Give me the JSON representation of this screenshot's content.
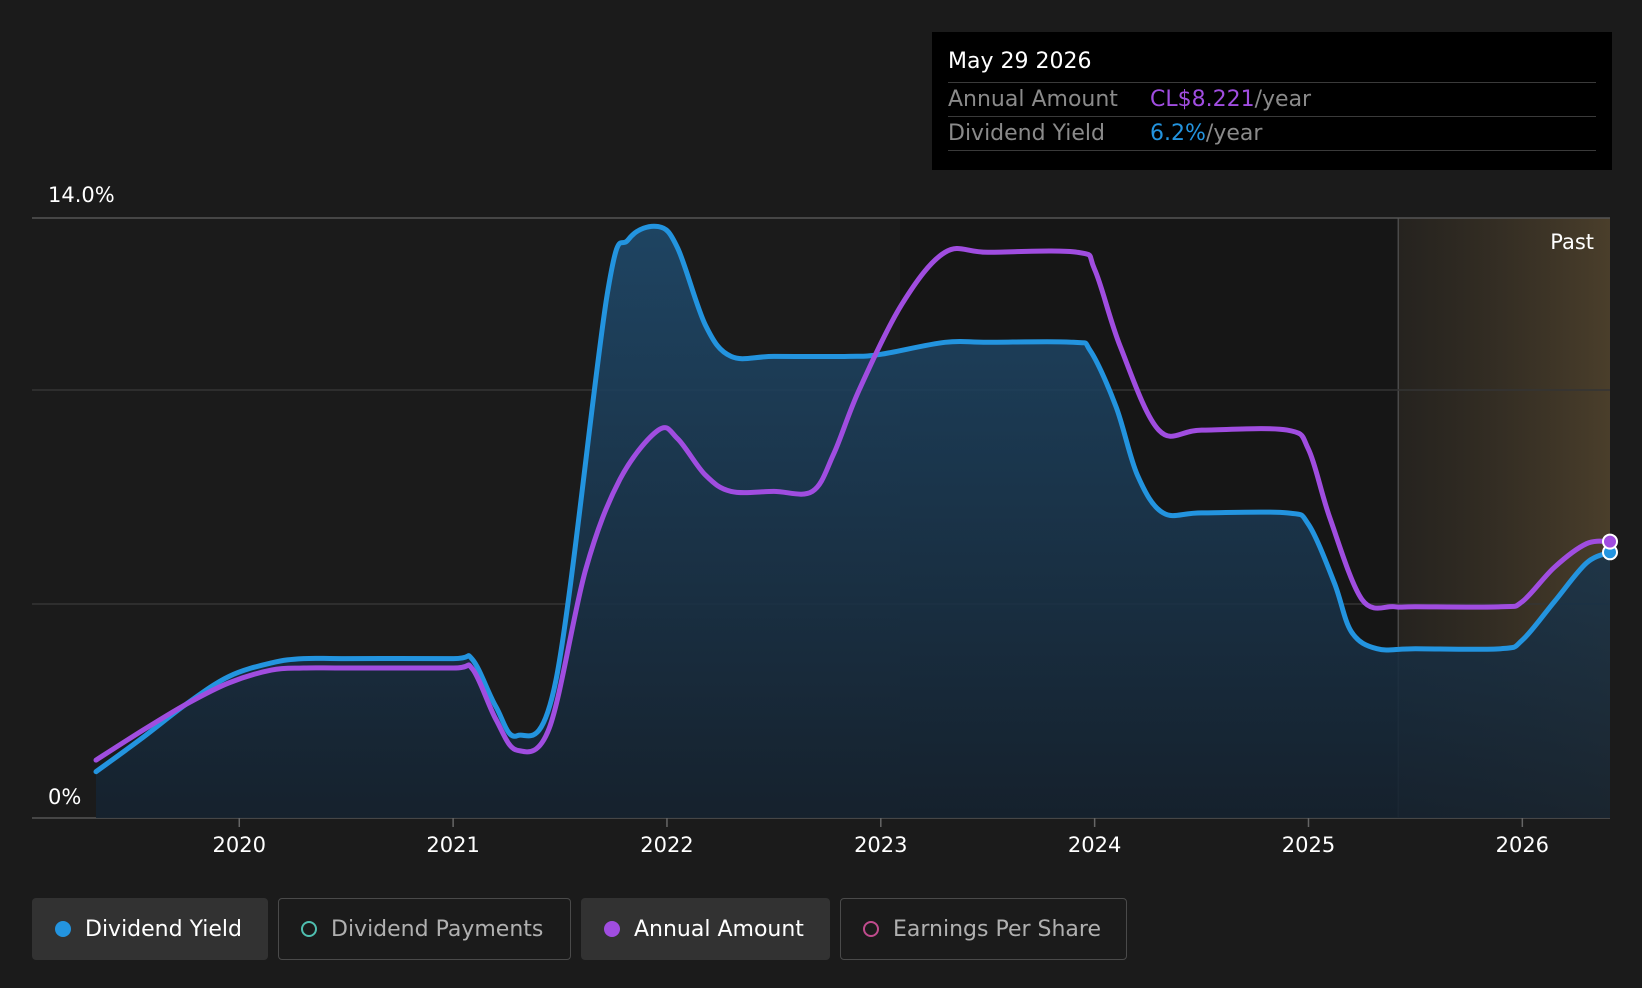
{
  "chart_data": {
    "type": "line",
    "y_top_label": "14.0%",
    "y_bottom_label": "0%",
    "ylim": [
      0,
      14
    ],
    "x_range": [
      2019.33,
      2026.41
    ],
    "x_ticks": [
      "2020",
      "2021",
      "2022",
      "2023",
      "2024",
      "2025",
      "2026"
    ],
    "past_label": "Past",
    "past_start": 2025.42,
    "series": [
      {
        "name": "Dividend Yield",
        "color": "#2394df",
        "fill": true,
        "points": [
          [
            2019.33,
            1.08
          ],
          [
            2019.55,
            1.88
          ],
          [
            2019.75,
            2.65
          ],
          [
            2019.95,
            3.3
          ],
          [
            2020.15,
            3.62
          ],
          [
            2020.3,
            3.72
          ],
          [
            2020.5,
            3.72
          ],
          [
            2021.0,
            3.72
          ],
          [
            2021.09,
            3.7
          ],
          [
            2021.2,
            2.6
          ],
          [
            2021.3,
            1.92
          ],
          [
            2021.48,
            3.2
          ],
          [
            2021.72,
            12.2
          ],
          [
            2021.82,
            13.5
          ],
          [
            2021.96,
            13.8
          ],
          [
            2022.05,
            13.3
          ],
          [
            2022.18,
            11.5
          ],
          [
            2022.3,
            10.77
          ],
          [
            2022.5,
            10.77
          ],
          [
            2022.85,
            10.77
          ],
          [
            2023.0,
            10.82
          ],
          [
            2023.3,
            11.1
          ],
          [
            2023.5,
            11.1
          ],
          [
            2023.9,
            11.1
          ],
          [
            2023.98,
            10.9
          ],
          [
            2024.1,
            9.6
          ],
          [
            2024.2,
            8.0
          ],
          [
            2024.32,
            7.12
          ],
          [
            2024.5,
            7.12
          ],
          [
            2024.9,
            7.12
          ],
          [
            2025.0,
            6.85
          ],
          [
            2025.12,
            5.5
          ],
          [
            2025.2,
            4.35
          ],
          [
            2025.32,
            3.95
          ],
          [
            2025.5,
            3.95
          ],
          [
            2025.9,
            3.95
          ],
          [
            2026.0,
            4.15
          ],
          [
            2026.15,
            5.05
          ],
          [
            2026.3,
            5.95
          ],
          [
            2026.41,
            6.2
          ]
        ]
      },
      {
        "name": "Annual Amount",
        "color": "#a04de0",
        "fill": false,
        "points": [
          [
            2019.33,
            1.35
          ],
          [
            2019.55,
            2.05
          ],
          [
            2019.75,
            2.65
          ],
          [
            2019.95,
            3.15
          ],
          [
            2020.15,
            3.45
          ],
          [
            2020.3,
            3.5
          ],
          [
            2020.5,
            3.5
          ],
          [
            2021.0,
            3.5
          ],
          [
            2021.09,
            3.48
          ],
          [
            2021.2,
            2.3
          ],
          [
            2021.3,
            1.58
          ],
          [
            2021.45,
            2.1
          ],
          [
            2021.62,
            5.8
          ],
          [
            2021.78,
            7.9
          ],
          [
            2021.96,
            9.05
          ],
          [
            2022.05,
            8.85
          ],
          [
            2022.18,
            8.0
          ],
          [
            2022.3,
            7.62
          ],
          [
            2022.5,
            7.62
          ],
          [
            2022.68,
            7.62
          ],
          [
            2022.78,
            8.5
          ],
          [
            2022.9,
            10.0
          ],
          [
            2023.1,
            12.0
          ],
          [
            2023.3,
            13.2
          ],
          [
            2023.5,
            13.2
          ],
          [
            2023.92,
            13.2
          ],
          [
            2024.0,
            12.8
          ],
          [
            2024.12,
            11.0
          ],
          [
            2024.3,
            9.05
          ],
          [
            2024.5,
            9.05
          ],
          [
            2024.9,
            9.05
          ],
          [
            2025.0,
            8.6
          ],
          [
            2025.1,
            7.0
          ],
          [
            2025.25,
            5.1
          ],
          [
            2025.4,
            4.93
          ],
          [
            2025.5,
            4.93
          ],
          [
            2025.9,
            4.93
          ],
          [
            2026.0,
            5.05
          ],
          [
            2026.15,
            5.85
          ],
          [
            2026.3,
            6.4
          ],
          [
            2026.41,
            6.45
          ]
        ]
      }
    ],
    "tooltip": {
      "date": "May 29 2026",
      "rows": [
        {
          "label": "Annual Amount",
          "value": "CL$8.221",
          "unit": "/year",
          "color": "#a04de0"
        },
        {
          "label": "Dividend Yield",
          "value": "6.2%",
          "unit": "/year",
          "color": "#2394df"
        }
      ]
    },
    "legend": [
      {
        "label": "Dividend Yield",
        "color": "#2394df",
        "active": true
      },
      {
        "label": "Dividend Payments",
        "color": "#4fbfb0",
        "active": false
      },
      {
        "label": "Annual Amount",
        "color": "#a04de0",
        "active": true
      },
      {
        "label": "Earnings Per Share",
        "color": "#c04b8d",
        "active": false
      }
    ]
  }
}
